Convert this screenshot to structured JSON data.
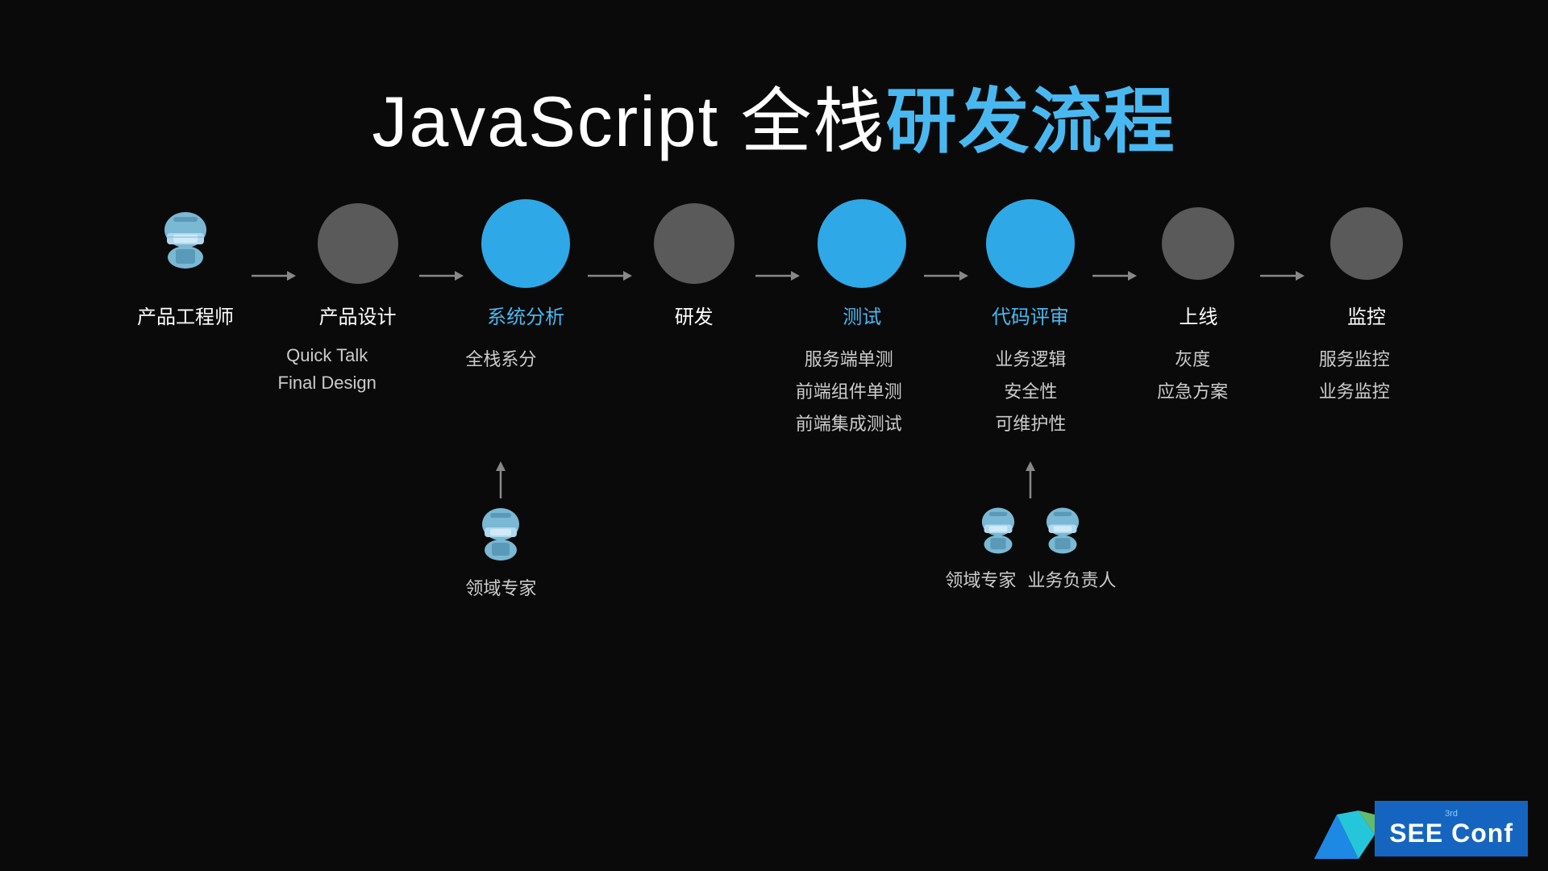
{
  "title": {
    "part1": "JavaScript 全栈",
    "part2": "研发流程",
    "color_white": "#ffffff",
    "color_blue": "#4ab8f0"
  },
  "flow": {
    "nodes": [
      {
        "id": "chanpin-engineer",
        "label": "产品工程师",
        "type": "person",
        "color": "person",
        "label_color": "white"
      },
      {
        "id": "chanpin-design",
        "label": "产品设计",
        "type": "circle",
        "color": "gray",
        "label_color": "white"
      },
      {
        "id": "xitong-analysis",
        "label": "系统分析",
        "type": "circle",
        "color": "blue",
        "label_color": "blue"
      },
      {
        "id": "yanfa",
        "label": "研发",
        "type": "circle",
        "color": "gray",
        "label_color": "white"
      },
      {
        "id": "ceshi",
        "label": "测试",
        "type": "circle",
        "color": "blue",
        "label_color": "blue"
      },
      {
        "id": "daima-review",
        "label": "代码评审",
        "type": "circle",
        "color": "blue",
        "label_color": "blue"
      },
      {
        "id": "shangxian",
        "label": "上线",
        "type": "circle",
        "color": "gray_small",
        "label_color": "white"
      },
      {
        "id": "jiankong",
        "label": "监控",
        "type": "circle",
        "color": "gray_small",
        "label_color": "white"
      }
    ],
    "sub_info": {
      "chanpin-design": [
        "Quick Talk",
        "Final Design"
      ],
      "xitong-analysis": [
        "全栈系分"
      ],
      "ceshi": [
        "服务端单测",
        "前端组件单测",
        "前端集成测试"
      ],
      "daima-review": [
        "业务逻辑",
        "安全性",
        "可维护性"
      ],
      "shangxian": [
        "灰度",
        "应急方案"
      ],
      "jiankong": [
        "服务监控",
        "业务监控"
      ]
    },
    "bottom_people": {
      "xitong-analysis": {
        "label": "领域专家",
        "has_arrow": true
      },
      "daima-review": {
        "label1": "领域专家",
        "label2": "业务负责人",
        "has_arrow": true
      }
    }
  },
  "see_conf": {
    "text": "SEE Conf",
    "sub": "3rd"
  }
}
